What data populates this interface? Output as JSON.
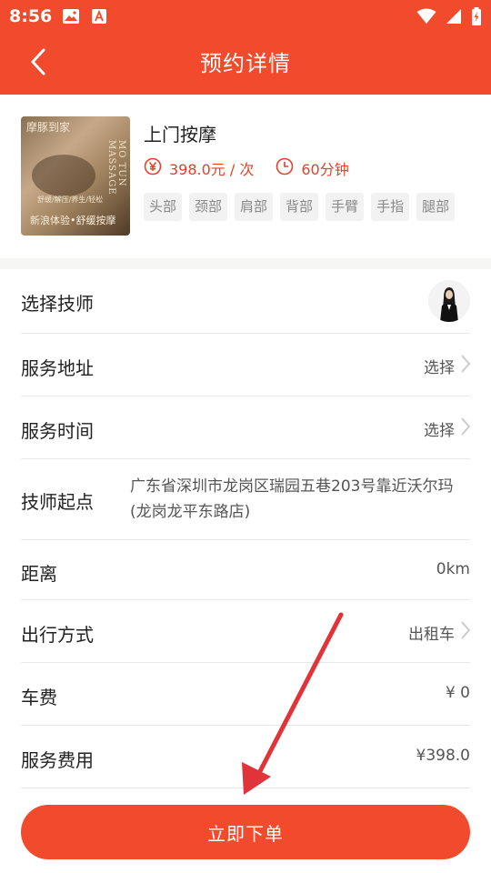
{
  "status_bar": {
    "time": "8:56",
    "left_icons": [
      "gallery-icon",
      "text-a-icon"
    ],
    "right_icons": [
      "wifi-icon",
      "cellular-icon",
      "battery-icon"
    ]
  },
  "nav": {
    "title": "预约详情",
    "back_icon": "chevron-left-icon"
  },
  "product": {
    "name": "上门按摩",
    "price": "398.0元 / 次",
    "duration": "60分钟",
    "tags": [
      "头部",
      "颈部",
      "肩部",
      "背部",
      "手臂",
      "手指",
      "腿部"
    ],
    "image_text": {
      "title": "摩豚到家",
      "vertical": "MO TUN MASSAGE",
      "small": "舒缓/解压/养生/轻松",
      "bottom": "新浪体验•舒缓按摩"
    }
  },
  "form": {
    "technician_label": "选择技师",
    "address_label": "服务地址",
    "address_value": "选择",
    "time_label": "服务时间",
    "time_value": "选择",
    "start_label": "技师起点",
    "start_value": "广东省深圳市龙岗区瑞园五巷203号靠近沃尔玛(龙岗龙平东路店)",
    "distance_label": "距离",
    "distance_value": "0km",
    "travel_label": "出行方式",
    "travel_value": "出租车",
    "fare_label": "车费",
    "fare_value": "¥ 0",
    "fee_label": "服务费用",
    "fee_value": "¥398.0"
  },
  "submit": {
    "label": "立即下单"
  },
  "colors": {
    "brand": "#f24a2c",
    "price": "#e5412a",
    "annotation_arrow": "#e0343a"
  }
}
